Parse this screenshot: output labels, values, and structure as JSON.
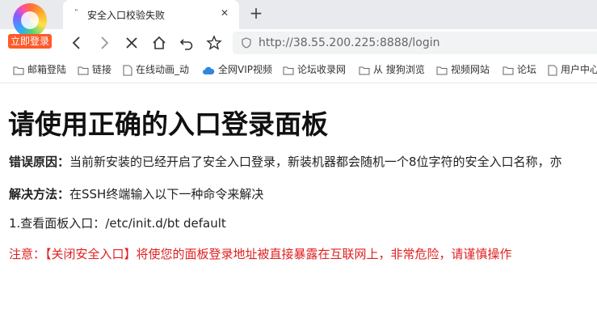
{
  "browser": {
    "login_badge": "立即登录",
    "tab": {
      "title": "安全入口校验失败"
    },
    "address": {
      "url": "http://38.55.200.225:8888/login"
    }
  },
  "bookmarks": [
    {
      "label": "邮箱登陆",
      "icon": "folder-icon"
    },
    {
      "label": "链接",
      "icon": "folder-icon"
    },
    {
      "label": "在线动画_动",
      "icon": "page-icon"
    },
    {
      "label": "全网VIP视频",
      "icon": "cloud-icon"
    },
    {
      "label": "论坛收录网",
      "icon": "folder-icon"
    },
    {
      "label": "从 搜狗浏览",
      "icon": "folder-icon"
    },
    {
      "label": "视频网站",
      "icon": "folder-icon"
    },
    {
      "label": "论坛",
      "icon": "folder-icon"
    },
    {
      "label": "用户中心",
      "icon": "page-icon"
    }
  ],
  "page": {
    "title": "请使用正确的入口登录面板",
    "reason_label": "错误原因：",
    "reason_text": "当前新安装的已经开启了安全入口登录，新装机器都会随机一个8位字符的安全入口名称，亦",
    "solution_label": "解决方法：",
    "solution_text": "在SSH终端输入以下一种命令来解决",
    "step1_label": "1.查看面板入口：",
    "step1_cmd": "/etc/init.d/bt default",
    "warning": "注意：【关闭安全入口】将使您的面板登录地址被直接暴露在互联网上，非常危险，请谨慎操作"
  },
  "colors": {
    "warning": "#e02020",
    "badge": "#ff5a2a",
    "tabstrip": "#e8eaed"
  }
}
